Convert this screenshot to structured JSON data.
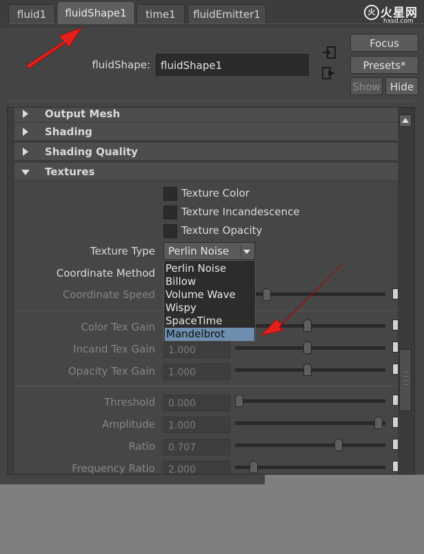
{
  "tabs": [
    "fluid1",
    "fluidShape1",
    "time1",
    "fluidEmitter1"
  ],
  "active_tab": "fluidShape1",
  "watermark": {
    "big": "火星网",
    "small": "hxsd.com"
  },
  "header": {
    "node_label": "fluidShape:",
    "node_value": "fluidShape1",
    "buttons": {
      "focus": "Focus",
      "presets": "Presets*",
      "show": "Show",
      "hide": "Hide"
    }
  },
  "frames": {
    "output_mesh": "Output Mesh",
    "shading": "Shading",
    "shading_quality": "Shading Quality",
    "textures": "Textures"
  },
  "textures": {
    "checkboxes": [
      "Texture Color",
      "Texture Incandescence",
      "Texture Opacity"
    ],
    "texture_type_label": "Texture Type",
    "texture_type_value": "Perlin Noise",
    "coordinate_method_label": "Coordinate Method",
    "coordinate_speed_label": "Coordinate Speed",
    "menu_options": [
      "Perlin Noise",
      "Billow",
      "Volume Wave",
      "Wispy",
      "SpaceTime",
      "Mandelbrot"
    ],
    "menu_highlighted": "Mandelbrot",
    "gains": [
      {
        "label": "Color Tex Gain",
        "value": "",
        "slider": 0.48
      },
      {
        "label": "Incand Tex Gain",
        "value": "1.000",
        "slider": 0.48
      },
      {
        "label": "Opacity Tex Gain",
        "value": "1.000",
        "slider": 0.48
      }
    ],
    "noise": [
      {
        "label": "Threshold",
        "value": "0.000",
        "slider": 0.0
      },
      {
        "label": "Amplitude",
        "value": "1.000",
        "slider": 0.98
      },
      {
        "label": "Ratio",
        "value": "0.707",
        "slider": 0.7
      },
      {
        "label": "Frequency Ratio",
        "value": "2.000",
        "slider": 0.1
      }
    ]
  },
  "colors": {
    "arrow": "#e3211c",
    "highlight": "#6d8eaf",
    "panel": "#444444"
  }
}
